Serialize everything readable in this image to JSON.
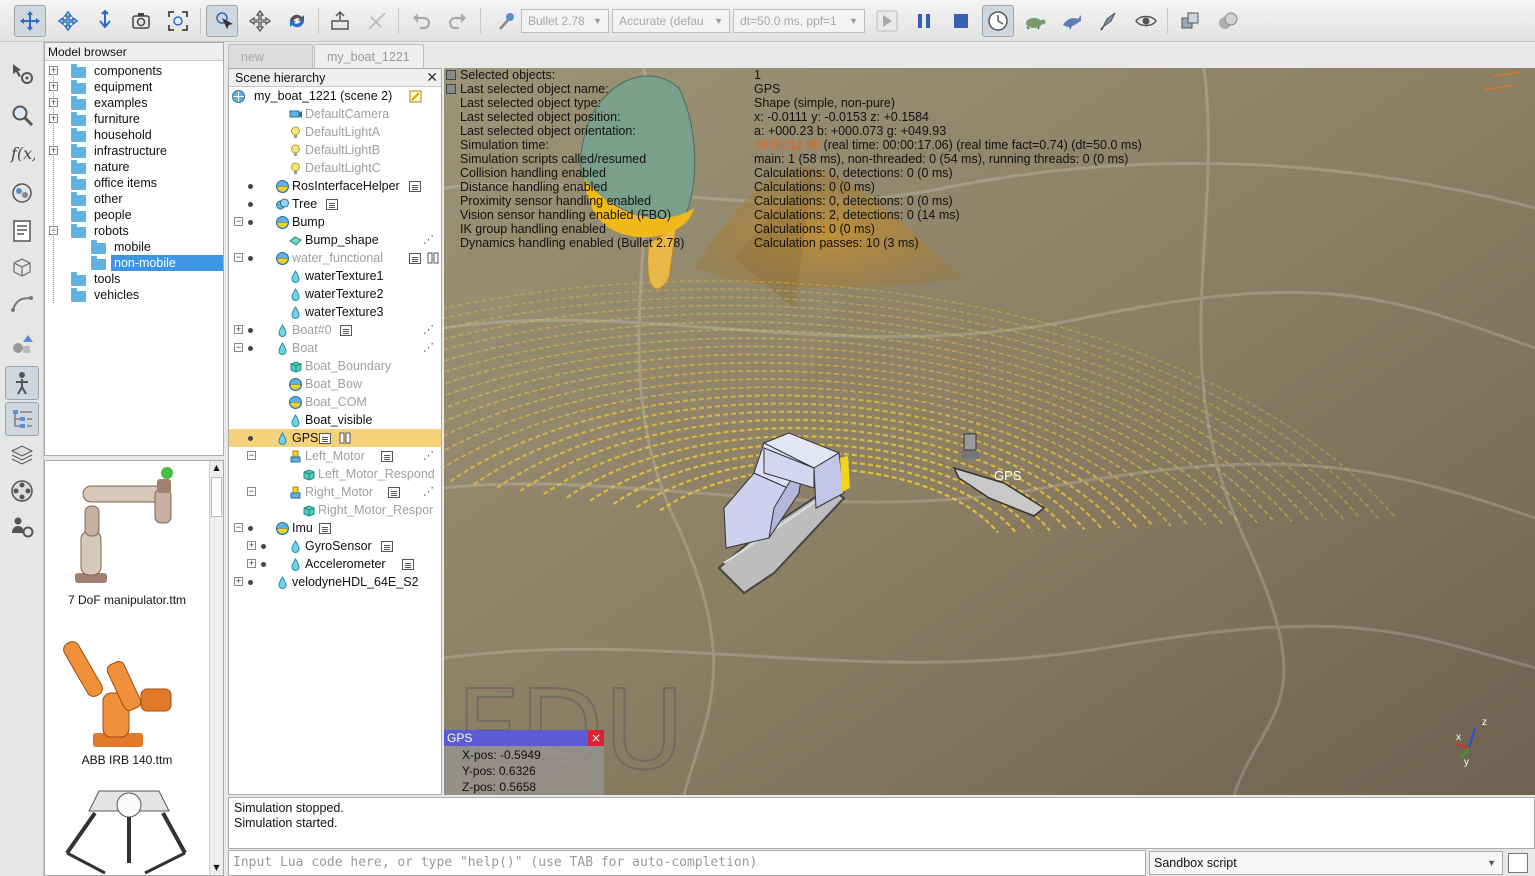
{
  "toolbar": {
    "physics_engine": "Bullet 2.78",
    "accuracy": "Accurate (defau",
    "timestep": "dt=50.0 ms, ppf=1"
  },
  "model_browser": {
    "title": "Model browser",
    "items": [
      {
        "label": "components",
        "expandable": true
      },
      {
        "label": "equipment",
        "expandable": true
      },
      {
        "label": "examples",
        "expandable": true
      },
      {
        "label": "furniture",
        "expandable": true
      },
      {
        "label": "household",
        "expandable": false
      },
      {
        "label": "infrastructure",
        "expandable": true
      },
      {
        "label": "nature",
        "expandable": false
      },
      {
        "label": "office items",
        "expandable": false
      },
      {
        "label": "other",
        "expandable": false
      },
      {
        "label": "people",
        "expandable": false
      },
      {
        "label": "robots",
        "expandable": true
      },
      {
        "label": "mobile",
        "expandable": false
      },
      {
        "label": "non-mobile",
        "expandable": false,
        "selected": true
      },
      {
        "label": "tools",
        "expandable": false
      },
      {
        "label": "vehicles",
        "expandable": false
      }
    ]
  },
  "thumbnails": [
    {
      "label": "7 DoF manipulator.ttm"
    },
    {
      "label": "ABB IRB 140.ttm"
    }
  ],
  "tabs": [
    {
      "label": "new scene",
      "active": false
    },
    {
      "label": "my_boat_1221",
      "active": true
    }
  ],
  "hierarchy": {
    "title": "Scene hierarchy",
    "root": "my_boat_1221 (scene 2)",
    "items": [
      {
        "label": "DefaultCamera"
      },
      {
        "label": "DefaultLightA"
      },
      {
        "label": "DefaultLightB"
      },
      {
        "label": "DefaultLightC"
      },
      {
        "label": "RosInterfaceHelper"
      },
      {
        "label": "Tree"
      },
      {
        "label": "Bump"
      },
      {
        "label": "Bump_shape"
      },
      {
        "label": "water_functional"
      },
      {
        "label": "waterTexture1"
      },
      {
        "label": "waterTexture2"
      },
      {
        "label": "waterTexture3"
      },
      {
        "label": "Boat#0"
      },
      {
        "label": "Boat"
      },
      {
        "label": "Boat_Boundary"
      },
      {
        "label": "Boat_Bow"
      },
      {
        "label": "Boat_COM"
      },
      {
        "label": "Boat_visible"
      },
      {
        "label": "GPS"
      },
      {
        "label": "Left_Motor"
      },
      {
        "label": "Left_Motor_Respond"
      },
      {
        "label": "Right_Motor"
      },
      {
        "label": "Right_Motor_Respor"
      },
      {
        "label": "Imu"
      },
      {
        "label": "GyroSensor"
      },
      {
        "label": "Accelerometer"
      },
      {
        "label": "velodyneHDL_64E_S2"
      }
    ]
  },
  "info": {
    "labels": [
      "Selected objects:",
      "Last selected object name:",
      "Last selected object type:",
      "Last selected object position:",
      "Last selected object orientation:",
      "Simulation time:",
      "Simulation scripts called/resumed",
      "Collision handling enabled",
      "Distance handling enabled",
      "Proximity sensor handling enabled",
      "Vision sensor handling enabled (FBO)",
      "IK group handling enabled",
      "Dynamics handling enabled (Bullet 2.78)"
    ],
    "values": [
      "1",
      "GPS",
      "Shape (simple, non-pure)",
      "x: -0.0111    y: -0.0153    z: +0.1584",
      "a: +000.23    b: +000.073    g: +049.93",
      "(real time: 00:00:17.06) (real time fact=0.74) (dt=50.0 ms)",
      "main: 1 (58 ms), non-threaded: 0 (54 ms), running threads: 0 (0 ms)",
      "Calculations: 0, detections: 0 (0 ms)",
      "Calculations: 0 (0 ms)",
      "Calculations: 0, detections: 0 (0 ms)",
      "Calculations: 2, detections: 0 (14 ms)",
      "Calculations: 0 (0 ms)",
      "Calculation passes: 10 (3 ms)"
    ],
    "sim_time": "00:00:12.60"
  },
  "viewport": {
    "gps_label": "GPS",
    "watermark": "FDU",
    "axis_z": "z",
    "axis_x": "x",
    "axis_y": "y"
  },
  "gps_panel": {
    "title": "GPS",
    "close": "×",
    "x": "X-pos: -0.5949",
    "y": "Y-pos: 0.6326",
    "z": "Z-pos: 0.5658"
  },
  "console": {
    "lines": [
      "Simulation stopped.",
      "Simulation started."
    ],
    "input_placeholder": "Input Lua code here, or type \"help()\" (use TAB for auto-completion)",
    "sandbox": "Sandbox script"
  },
  "colors": {
    "selection": "#3d95e4",
    "hierarchy_selection": "#f6d27a",
    "sensor_rays": "#e8c23a",
    "gps_header": "#5b5bd6"
  }
}
